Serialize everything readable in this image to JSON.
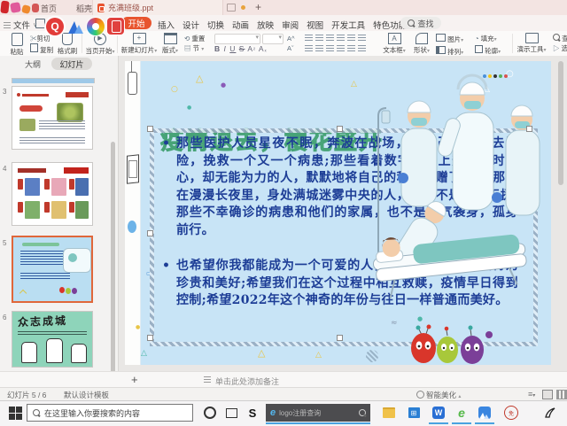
{
  "titlebar": {
    "tab_home": "首页",
    "tab_docer": "稻壳",
    "doc_name": "充满班级.ppt",
    "new_tab": "+"
  },
  "ribbon": {
    "file_menu": "文件",
    "tabs": [
      "开始",
      "插入",
      "设计",
      "切换",
      "动画",
      "放映",
      "审阅",
      "视图",
      "开发工具",
      "特色功能"
    ],
    "find_label": "查找"
  },
  "toolbar": {
    "paste": "粘贴",
    "cut": "剪切",
    "copy": "复制",
    "format_painter": "格式刷",
    "play_current": "当页开始",
    "new_slide": "新建幻灯片",
    "layout": "版式",
    "reset": "重置",
    "section": "节",
    "bold": "B",
    "italic": "I",
    "underline": "U",
    "strike": "S",
    "textbox": "文本框",
    "shapes": "形状",
    "picture": "图片",
    "fill": "填充",
    "arrange": "排列",
    "outline_btn": "轮廓",
    "present_tools": "演示工具",
    "find_small": "查找",
    "select_small": "选择"
  },
  "sidebar": {
    "tab_outline": "大纲",
    "tab_slides": "幻灯片",
    "slide_numbers": [
      "3",
      "4",
      "5",
      "6"
    ],
    "slide6_title": "众志成城",
    "add_slide": "+"
  },
  "slide": {
    "bg_title": "疫情退去，樱花盛开",
    "bullet_char": "•",
    "bullet1": "那些医护人员星夜不眠，奔波在战场，用自己的生命去冒险，挽救一个又一个病患;那些看着数字不断上升，时时揪心，却无能为力的人，默默地将自己的积蓄捐赠了出去;那些在漫漫长夜里，身处满城迷雾中央的人，他们不是孤立无援;那些不幸确诊的病患和他们的家属，也不是寒气袭身，孤身前行。",
    "bullet2": "也希望你我都能成为一个可爱的人，能够去体会温柔相待的珍贵和美好;希望我们在这个过程中相互救赎，疫情早日得到控制;希望2022年这个神奇的年份与往日一样普通而美好。"
  },
  "notes": {
    "placeholder": "单击此处添加备注"
  },
  "statusbar": {
    "slide_counter": "幻灯片 5 / 6",
    "template_name": "默认设计模板",
    "smart_beautify": "智能美化"
  },
  "taskbar": {
    "search_placeholder": "在这里输入你要搜索的内容",
    "widget_text": "logo注册查询"
  },
  "colors": {
    "accent_orange": "#e8542e",
    "selection_orange": "#e0673a",
    "slide_bg": "#c8e4f6",
    "body_text_blue": "#1d3d96",
    "title_green": "#5fbd8f"
  }
}
